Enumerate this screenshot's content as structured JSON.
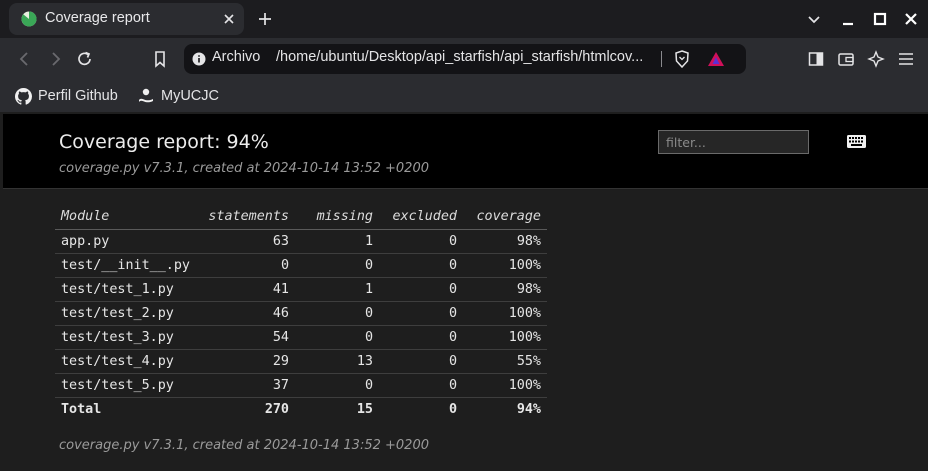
{
  "browser": {
    "tab": {
      "title": "Coverage report"
    },
    "address": {
      "chip": "Archivo",
      "url": "/home/ubuntu/Desktop/api_starfish/api_starfish/htmlcov..."
    },
    "bookmarks": [
      {
        "label": "Perfil Github",
        "icon": "github-icon"
      },
      {
        "label": "MyUCJC",
        "icon": "person-icon"
      }
    ]
  },
  "report": {
    "title": "Coverage report: 94%",
    "subtitle": "coverage.py v7.3.1, created at 2024-10-14 13:52 +0200",
    "filter_placeholder": "filter...",
    "columns": [
      "Module",
      "statements",
      "missing",
      "excluded",
      "coverage"
    ],
    "rows": [
      {
        "module": "app.py",
        "statements": "63",
        "missing": "1",
        "excluded": "0",
        "coverage": "98%"
      },
      {
        "module": "test/__init__.py",
        "statements": "0",
        "missing": "0",
        "excluded": "0",
        "coverage": "100%"
      },
      {
        "module": "test/test_1.py",
        "statements": "41",
        "missing": "1",
        "excluded": "0",
        "coverage": "98%"
      },
      {
        "module": "test/test_2.py",
        "statements": "46",
        "missing": "0",
        "excluded": "0",
        "coverage": "100%"
      },
      {
        "module": "test/test_3.py",
        "statements": "54",
        "missing": "0",
        "excluded": "0",
        "coverage": "100%"
      },
      {
        "module": "test/test_4.py",
        "statements": "29",
        "missing": "13",
        "excluded": "0",
        "coverage": "55%"
      },
      {
        "module": "test/test_5.py",
        "statements": "37",
        "missing": "0",
        "excluded": "0",
        "coverage": "100%"
      }
    ],
    "total": {
      "module": "Total",
      "statements": "270",
      "missing": "15",
      "excluded": "0",
      "coverage": "94%"
    },
    "footer": "coverage.py v7.3.1, created at 2024-10-14 13:52 +0200"
  },
  "colors": {
    "accent": "#1a73e8",
    "page_bg": "#1e1e1e",
    "header_bg": "#000000"
  }
}
